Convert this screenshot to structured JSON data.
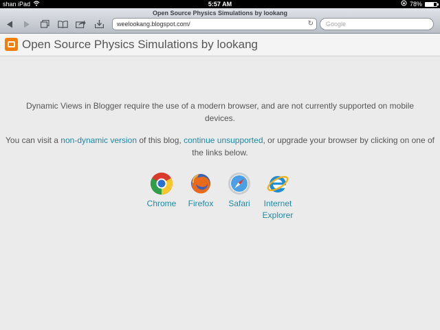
{
  "status_bar": {
    "carrier": "shan iPad",
    "time": "5:57 AM",
    "battery": "78%",
    "battery_level": 0.78
  },
  "browser": {
    "tab_title": "Open Source Physics Simulations by lookang",
    "url": "weelookang.blogspot.com/",
    "search_placeholder": "Google"
  },
  "blog": {
    "title": "Open Source Physics Simulations by lookang"
  },
  "message": {
    "line1": "Dynamic Views in Blogger require the use of a modern browser, and are not currently supported on mobile devices.",
    "p2_a": "You can visit a ",
    "link_nondynamic": "non-dynamic version",
    "p2_b": " of this blog, ",
    "link_continue": "continue unsupported",
    "p2_c": ", or upgrade your browser by clicking on one of the links below."
  },
  "browsers": [
    {
      "label": "Chrome"
    },
    {
      "label": "Firefox"
    },
    {
      "label": "Safari"
    },
    {
      "label": "Internet Explorer"
    }
  ]
}
